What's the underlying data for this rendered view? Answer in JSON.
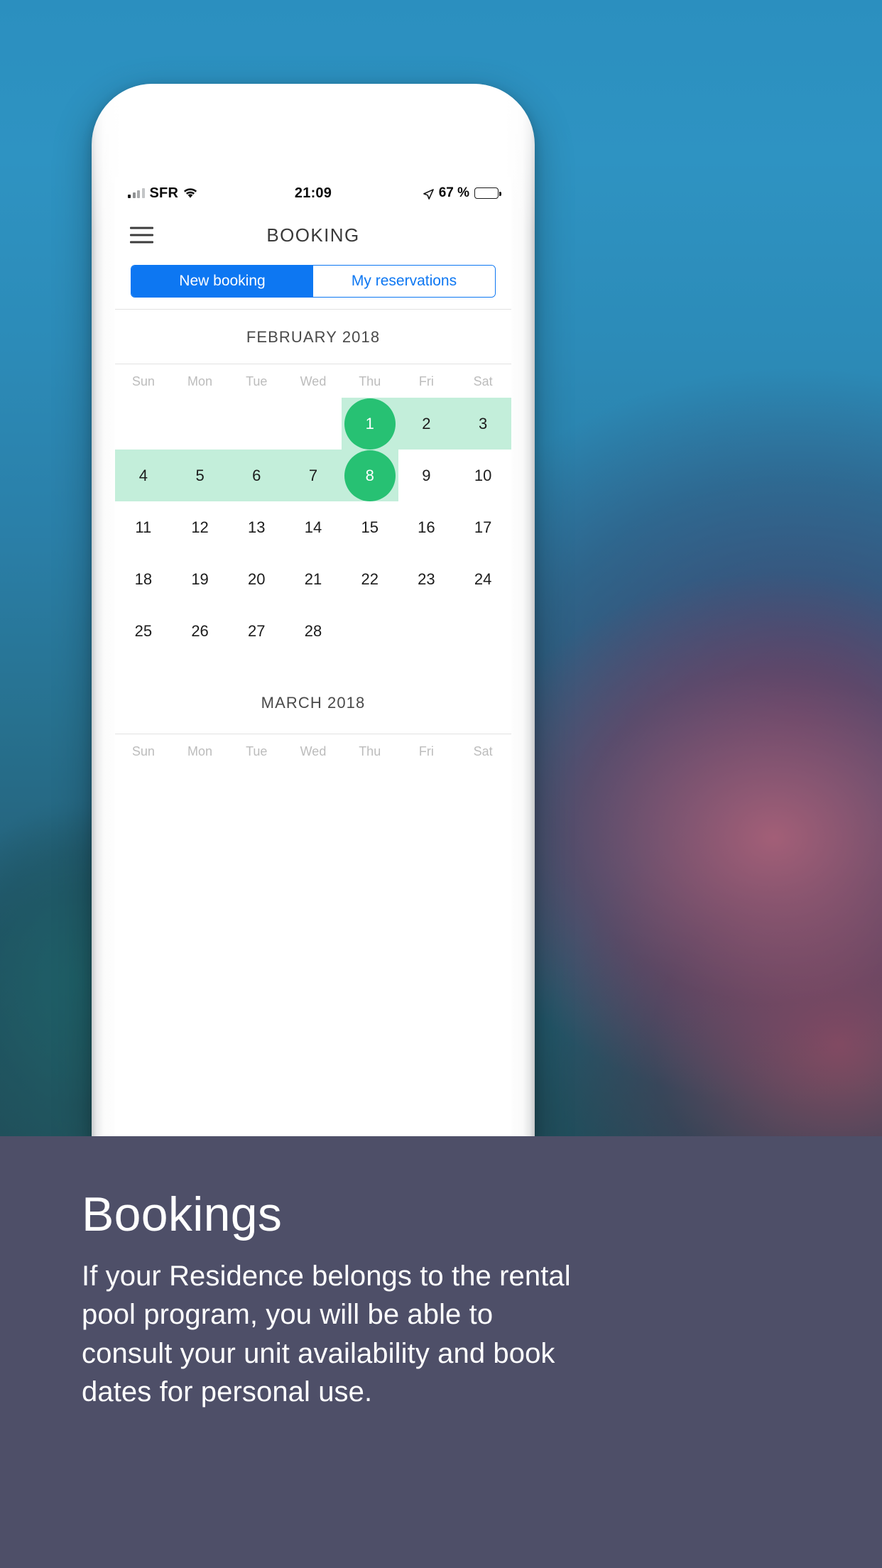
{
  "background": {
    "top_color": "#2b8fbf",
    "bottom_color": "#1b3c46"
  },
  "phone": {
    "frame_color": "#ffffff",
    "speaker_label": "earpiece-speaker",
    "camera_label": "front-camera"
  },
  "status_bar": {
    "carrier": "SFR",
    "signal_icon": "signal-bars-icon",
    "wifi_icon": "wifi-icon",
    "time": "21:09",
    "location_icon": "location-arrow-icon",
    "battery_percent": "67 %",
    "battery_icon": "battery-icon",
    "battery_level": 67
  },
  "nav": {
    "menu_icon": "hamburger-menu-icon",
    "title": "BOOKING"
  },
  "segmented": {
    "tabs": [
      {
        "label": "New booking",
        "active": true
      },
      {
        "label": "My reservations",
        "active": false
      }
    ],
    "active_bg": "#0d77f2",
    "active_fg": "#ffffff",
    "inactive_fg": "#0d77f2"
  },
  "calendar": {
    "weekday_labels": [
      "Sun",
      "Mon",
      "Tue",
      "Wed",
      "Thu",
      "Fri",
      "Sat"
    ],
    "selection_range_color": "#c3eeda",
    "selection_endpoint_color": "#27c173",
    "months": [
      {
        "title": "FEBRUARY 2018",
        "weeks": [
          {
            "days": [
              "",
              "",
              "",
              "",
              "1",
              "2",
              "3"
            ],
            "range_start_col": 4,
            "range_end_col": 6,
            "range_open_end": true,
            "pill_col": 4,
            "pill_day": "1"
          },
          {
            "days": [
              "4",
              "5",
              "6",
              "7",
              "8",
              "9",
              "10"
            ],
            "range_start_col": 0,
            "range_end_col": 4,
            "range_open_start": true,
            "pill_col": 4,
            "pill_day": "8"
          },
          {
            "days": [
              "11",
              "12",
              "13",
              "14",
              "15",
              "16",
              "17"
            ]
          },
          {
            "days": [
              "18",
              "19",
              "20",
              "21",
              "22",
              "23",
              "24"
            ]
          },
          {
            "days": [
              "25",
              "26",
              "27",
              "28",
              "",
              "",
              ""
            ]
          }
        ]
      },
      {
        "title": "MARCH 2018",
        "weeks": []
      }
    ]
  },
  "caption": {
    "heading": "Bookings",
    "body": "If your Residence belongs to the rental pool program, you will be able to consult your unit availability and book dates for personal use.",
    "background_color": "#4e4f68",
    "text_color": "#ffffff"
  }
}
